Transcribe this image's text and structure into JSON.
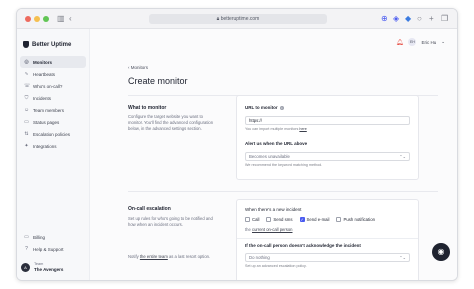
{
  "browser": {
    "url": "betteruptime.com",
    "icons": [
      "sidebar-icon",
      "back-icon",
      "lock-icon",
      "share-icon",
      "extension-icon",
      "shield-icon",
      "circle-icon",
      "plus-icon",
      "tabs-icon"
    ]
  },
  "sidebar": {
    "brand": "Better Uptime",
    "items": [
      {
        "label": "Monitors",
        "icon": "globe-icon",
        "glyph": "◎",
        "active": true
      },
      {
        "label": "Heartbeats",
        "icon": "heartbeat-icon",
        "glyph": "∿",
        "active": false
      },
      {
        "label": "Who's on-call?",
        "icon": "phone-icon",
        "glyph": "☏",
        "active": false
      },
      {
        "label": "Incidents",
        "icon": "shield-icon",
        "glyph": "⛉",
        "active": false
      },
      {
        "label": "Team members",
        "icon": "users-icon",
        "glyph": "☺",
        "active": false
      },
      {
        "label": "Status pages",
        "icon": "status-icon",
        "glyph": "▭",
        "active": false
      },
      {
        "label": "Escalation policies",
        "icon": "escalation-icon",
        "glyph": "⇅",
        "active": false
      },
      {
        "label": "Integrations",
        "icon": "puzzle-icon",
        "glyph": "✦",
        "active": false
      }
    ],
    "bottom": [
      {
        "label": "Billing",
        "icon": "card-icon",
        "glyph": "▭"
      },
      {
        "label": "Help & Support",
        "icon": "help-icon",
        "glyph": "?"
      }
    ],
    "team": {
      "caption": "Team",
      "name": "The Avengers",
      "initials": "A"
    }
  },
  "header": {
    "user_name": "Eric Hu",
    "user_initials": "EH",
    "accent": "#e6463c"
  },
  "breadcrumb": "Monitors",
  "page_title": "Create monitor",
  "what_to_monitor": {
    "title": "What to monitor",
    "desc": "Configure the target website you want to monitor. You'll find the advanced configuration below, in the advanced settings section.",
    "url_label": "URL to monitor",
    "url_value": "https://",
    "url_hint_prefix": "You can import multiple monitors ",
    "url_hint_link": "here",
    "alert_label": "Alert us when the URL above",
    "alert_value": "Becomes unavailable",
    "alert_hint": "We recommend the keyword matching method."
  },
  "oncall": {
    "title": "On-call escalation",
    "desc": "Set up rules for who's going to be notified and how when an incident occurs.",
    "note_prefix": "Notify ",
    "note_link": "the entire team",
    "note_suffix": " as a last resort option.",
    "new_incident_label": "When there's a new incident",
    "options": [
      {
        "label": "Call",
        "checked": false
      },
      {
        "label": "Send sms",
        "checked": false
      },
      {
        "label": "Send e-mail",
        "checked": true
      },
      {
        "label": "Push notification",
        "checked": false
      }
    ],
    "the_label": "the ",
    "current_link": "current on-call person",
    "ack_label": "If the on-call person doesn't acknowledge the incident",
    "ack_value": "Do nothing",
    "ack_hint": "Set up an advanced escalation policy."
  },
  "accent_blue": "#4a5bf0"
}
